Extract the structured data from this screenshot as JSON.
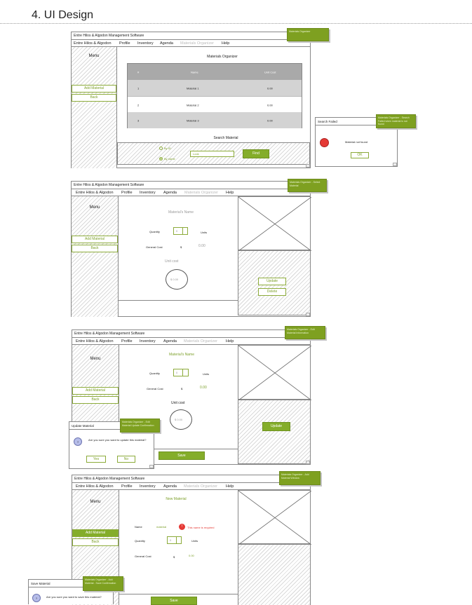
{
  "doc": {
    "heading": "4.  UI Design"
  },
  "app": {
    "title": "Entre Hilos & Algodon Management Software",
    "menu": {
      "home": "Entre Hilos & Algodon",
      "profile": "Profile",
      "inventory": "Inventory",
      "agenda": "Agenda",
      "materials": "Materials Organizer",
      "help": "Help"
    },
    "side": {
      "menu_label": "Menu",
      "add_material": "Add Material",
      "back": "Back"
    }
  },
  "screen1": {
    "title": "Materials Organizer",
    "table": {
      "headers": [
        "#",
        "Name",
        "Unit Cost"
      ],
      "rows": [
        [
          "1",
          "Material 1",
          "0.00"
        ],
        [
          "2",
          "Material 2",
          "0.00"
        ],
        [
          "3",
          "Material 3",
          "0.00"
        ]
      ]
    },
    "search": {
      "title": "Search Material",
      "opt_id": "By ID",
      "opt_name": "By name",
      "placeholder": "Look",
      "find": "Find"
    },
    "note": "Materials Organizer",
    "dialog": {
      "title": "Search Failed",
      "message": "Material not found",
      "ok": "OK"
    },
    "dialog_note": "Materials Organizer - Search Failed when material is not found"
  },
  "screen2": {
    "name": "Material's Name",
    "quantity_label": "Quantity",
    "quantity": "0",
    "units": "Units",
    "general_cost_label": "General Cost",
    "currency": "$",
    "general_cost": "0.00",
    "unit_cost_label": "Unit cost",
    "unit_cost": "$ 0.00",
    "update": "Update",
    "delete": "Delete",
    "note": "Materials Organizer - Select Material"
  },
  "screen3": {
    "name": "Material's Name",
    "quantity_label": "Quantity",
    "quantity": "0",
    "units": "Units",
    "general_cost_label": "General Cost",
    "currency": "$",
    "general_cost": "0.00",
    "unit_cost_label": "Unit cost",
    "unit_cost": "$ 0.00",
    "update": "Update",
    "save": "Save",
    "note": "Materials Organizer - Edit Material Information",
    "dialog": {
      "title": "Update Material",
      "icon": "?",
      "message": "Are you sure you want to update this material?",
      "yes": "Yes",
      "no": "No"
    },
    "dialog_note": "Materials Organizer - Edit Material Update Confirmation"
  },
  "screen4": {
    "title": "New Material",
    "name_label": "Name",
    "name_value": "material",
    "error_icon": "!",
    "error_text": "This name is required",
    "quantity_label": "Quantity",
    "quantity": "0",
    "units": "Units",
    "general_cost_label": "General Cost",
    "currency": "$",
    "general_cost": "0.00",
    "save": "Save",
    "note": "Materials Organizer - Add Material Window",
    "dialog": {
      "title": "Save Material",
      "icon": "?",
      "message": "Are you sure you want to save this material?"
    },
    "dialog_note": "Materials Organizer - Add Material - Save Confirmation"
  },
  "colors": {
    "accent": "#84ad2a",
    "error": "#e53935"
  }
}
